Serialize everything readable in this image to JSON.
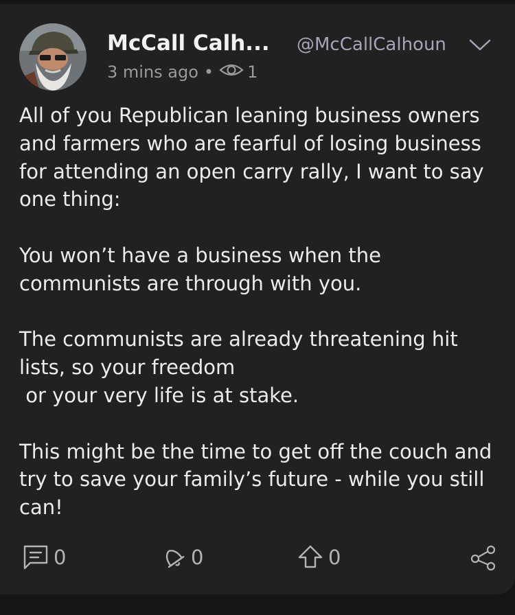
{
  "post": {
    "author_name": "McCall Calh...",
    "author_handle": "@McCallCalhoun",
    "time_ago": "3 mins ago",
    "separator": "•",
    "view_count": "1",
    "paragraphs": [
      "All of you Republican leaning business owners and farmers who are fearful of losing business for attending an open carry rally, I want to say one thing:",
      "You won’t have a business when the communists are through with you.",
      "The communists are already threatening hit lists, so your freedom\n or your very life is at stake.",
      "This might be the time to get off the couch and try to save your family’s future - while you still can!"
    ]
  },
  "actions": {
    "comment_count": "0",
    "like_count": "0",
    "repost_count": "0"
  },
  "icons": {
    "menu": "chevron-down-icon",
    "views": "eye-icon",
    "comment": "comment-icon",
    "like": "bell-icon",
    "repost": "upvote-arrow-icon",
    "share": "share-icon"
  },
  "colors": {
    "background": "#151515",
    "card": "#212121",
    "text": "#ececec",
    "muted": "#9a9a9a",
    "handle": "#a7a3b8"
  }
}
